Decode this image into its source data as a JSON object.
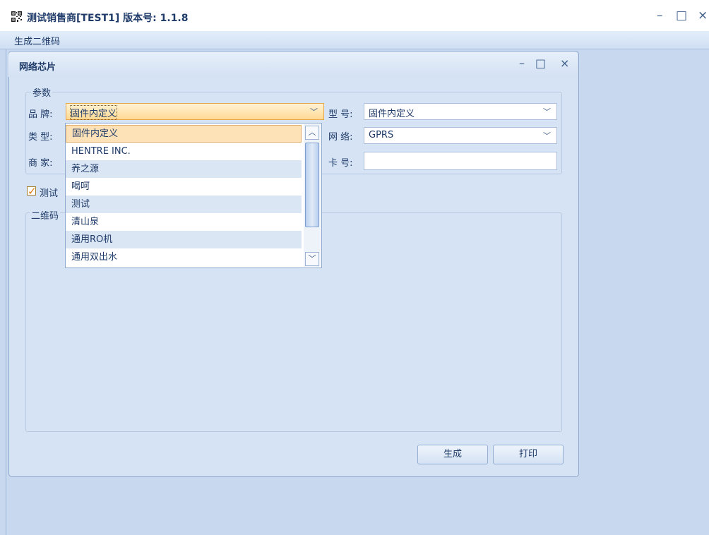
{
  "app": {
    "icon": "qr-code-icon",
    "title": "测试销售商[TEST1] 版本号: 1.1.8"
  },
  "menu": {
    "items": [
      "生成二维码"
    ]
  },
  "child_window": {
    "title": "网络芯片",
    "params_group": "参数",
    "labels": {
      "brand": "品 牌:",
      "type": "类 型:",
      "merchant": "商 家:",
      "model": "型 号:",
      "network": "网 络:",
      "card": "卡 号:"
    },
    "brand_value": "固件内定义",
    "model_value": "固件内定义",
    "network_value": "GPRS",
    "card_value": "",
    "test_checkbox": {
      "label": "测试",
      "checked": true
    },
    "qr_group": "二维码",
    "buttons": {
      "generate": "生成",
      "print": "打印"
    }
  },
  "brand_dropdown": {
    "options": [
      "固件内定义",
      "HENTRE INC.",
      "养之源",
      "喝呵",
      "测试",
      "清山泉",
      "通用RO机",
      "通用双出水"
    ],
    "selected_index": 0,
    "scroll_position": 0.0
  }
}
